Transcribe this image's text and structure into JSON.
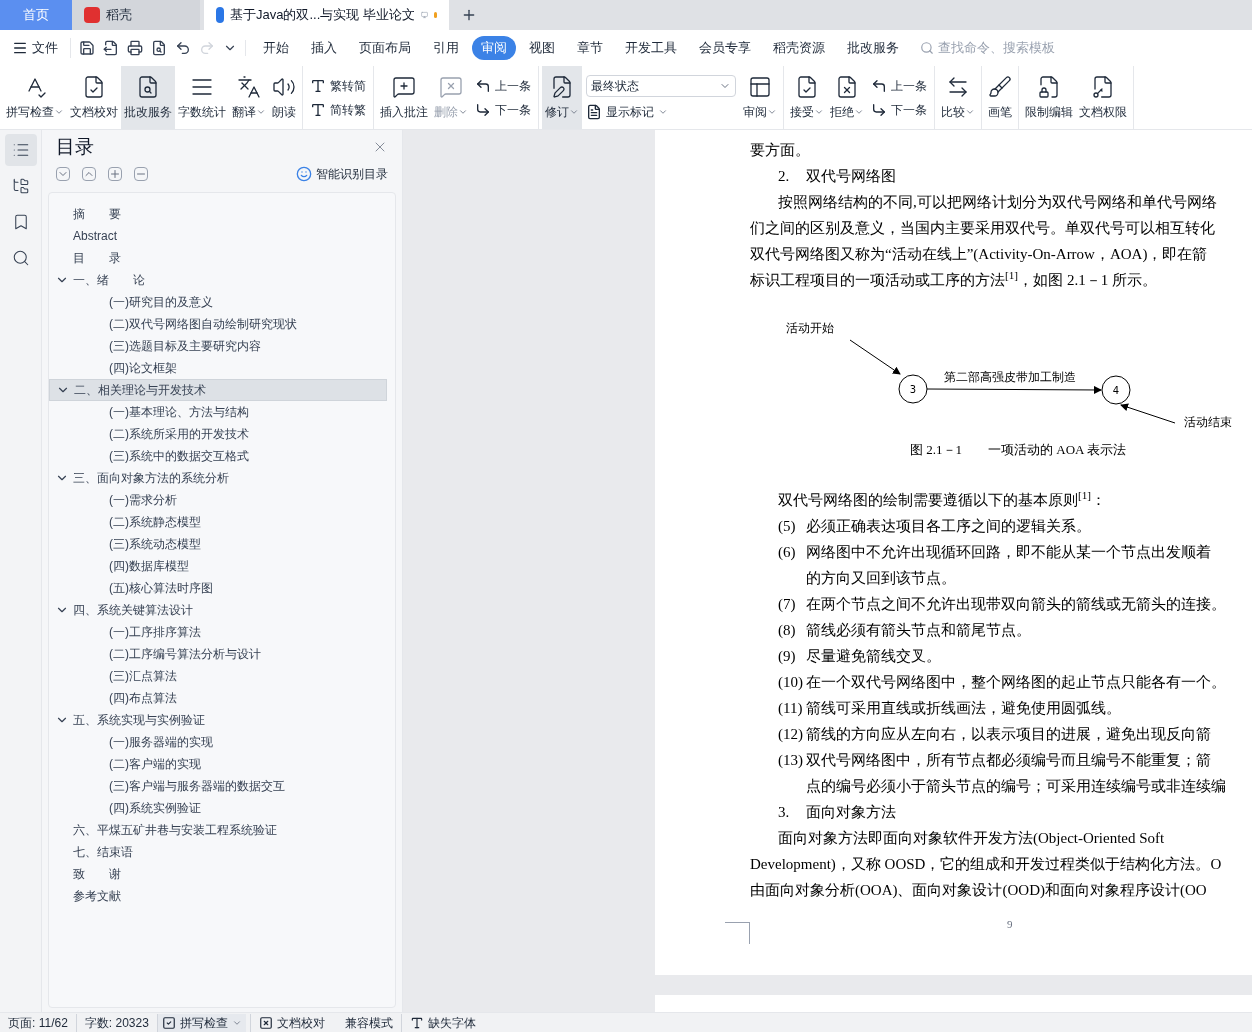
{
  "browser_tabs": [
    {
      "label": "首页",
      "kind": "home",
      "selected": false
    },
    {
      "label": "稻壳",
      "kind": "app",
      "selected": false
    },
    {
      "label": "基于Java的双...与实现 毕业论文",
      "kind": "doc",
      "selected": true,
      "unsaved": true
    }
  ],
  "menu": {
    "file": "文件",
    "tabs": [
      {
        "label": "开始",
        "selected": false
      },
      {
        "label": "插入",
        "selected": false
      },
      {
        "label": "页面布局",
        "selected": false
      },
      {
        "label": "引用",
        "selected": false
      },
      {
        "label": "审阅",
        "selected": true
      },
      {
        "label": "视图",
        "selected": false
      },
      {
        "label": "章节",
        "selected": false
      },
      {
        "label": "开发工具",
        "selected": false
      },
      {
        "label": "会员专享",
        "selected": false
      },
      {
        "label": "稻壳资源",
        "selected": false
      },
      {
        "label": "批改服务",
        "selected": false
      }
    ],
    "search": {
      "placeholder": "查找命令、搜索模板"
    }
  },
  "ribbon": {
    "groups": [
      {
        "items": [
          {
            "kind": "large",
            "label": "拼写检查",
            "has_menu": true,
            "selected": false,
            "disabled": false
          },
          {
            "kind": "large",
            "label": "文档校对",
            "has_menu": false,
            "selected": false,
            "disabled": false
          },
          {
            "kind": "large",
            "label": "批改服务",
            "has_menu": false,
            "selected": true,
            "disabled": false
          },
          {
            "kind": "large",
            "label": "字数统计",
            "has_menu": false,
            "selected": false,
            "disabled": false
          },
          {
            "kind": "large",
            "label": "翻译",
            "has_menu": true,
            "selected": false,
            "disabled": false
          },
          {
            "kind": "large",
            "label": "朗读",
            "has_menu": false,
            "selected": false,
            "disabled": false
          }
        ]
      },
      {
        "items": [
          {
            "kind": "stack",
            "items": [
              {
                "label": "繁转简"
              },
              {
                "label": "简转繁"
              }
            ]
          }
        ]
      },
      {
        "items": [
          {
            "kind": "large",
            "label": "插入批注",
            "has_menu": false,
            "selected": false,
            "disabled": false
          },
          {
            "kind": "large",
            "label": "删除",
            "has_menu": true,
            "selected": false,
            "disabled": true
          },
          {
            "kind": "stack",
            "items": [
              {
                "label": "上一条"
              },
              {
                "label": "下一条"
              }
            ]
          }
        ]
      },
      {
        "items": [
          {
            "kind": "large",
            "label": "修订",
            "has_menu": true,
            "selected": true,
            "disabled": false
          },
          {
            "kind": "select",
            "value": "最终状态",
            "option": "显示标记"
          },
          {
            "kind": "large",
            "label": "审阅",
            "has_menu": true,
            "selected": false,
            "disabled": false
          }
        ]
      },
      {
        "items": [
          {
            "kind": "large",
            "label": "接受",
            "has_menu": true,
            "selected": false,
            "disabled": false
          },
          {
            "kind": "large",
            "label": "拒绝",
            "has_menu": true,
            "selected": false,
            "disabled": false
          },
          {
            "kind": "stack",
            "items": [
              {
                "label": "上一条"
              },
              {
                "label": "下一条"
              }
            ]
          }
        ]
      },
      {
        "items": [
          {
            "kind": "large",
            "label": "比较",
            "has_menu": true,
            "selected": false,
            "disabled": false
          }
        ]
      },
      {
        "items": [
          {
            "kind": "large",
            "label": "画笔",
            "has_menu": false,
            "selected": false,
            "disabled": false
          }
        ]
      },
      {
        "items": [
          {
            "kind": "large",
            "label": "限制编辑",
            "has_menu": false,
            "selected": false,
            "disabled": false
          },
          {
            "kind": "large",
            "label": "文档权限",
            "has_menu": false,
            "selected": false,
            "disabled": false
          }
        ]
      }
    ]
  },
  "side_tools": [
    {
      "selected": true
    },
    {
      "selected": false
    },
    {
      "selected": false
    },
    {
      "selected": false
    }
  ],
  "toc": {
    "title": "目录",
    "smart_button": "智能识别目录",
    "items": [
      {
        "label": "摘　　要",
        "selected": false
      },
      {
        "label": "Abstract",
        "selected": false
      },
      {
        "label": "目　　录",
        "selected": false
      },
      {
        "label": "一、绪　　论",
        "selected": false,
        "expanded": true,
        "children": [
          {
            "label": "(一)研究目的及意义",
            "selected": false
          },
          {
            "label": "(二)双代号网络图自动绘制研究现状",
            "selected": false
          },
          {
            "label": "(三)选题目标及主要研究内容",
            "selected": false
          },
          {
            "label": "(四)论文框架",
            "selected": false
          }
        ]
      },
      {
        "label": "二、相关理论与开发技术",
        "selected": true,
        "expanded": true,
        "children": [
          {
            "label": "(一)基本理论、方法与结构",
            "selected": false
          },
          {
            "label": "(二)系统所采用的开发技术",
            "selected": false
          },
          {
            "label": "(三)系统中的数据交互格式",
            "selected": false
          }
        ]
      },
      {
        "label": "三、面向对象方法的系统分析",
        "selected": false,
        "expanded": true,
        "children": [
          {
            "label": "(一)需求分析",
            "selected": false
          },
          {
            "label": "(二)系统静态模型",
            "selected": false
          },
          {
            "label": "(三)系统动态模型",
            "selected": false
          },
          {
            "label": "(四)数据库模型",
            "selected": false
          },
          {
            "label": "(五)核心算法时序图",
            "selected": false
          }
        ]
      },
      {
        "label": "四、系统关键算法设计",
        "selected": false,
        "expanded": true,
        "children": [
          {
            "label": "(一)工序排序算法",
            "selected": false
          },
          {
            "label": "(二)工序编号算法分析与设计",
            "selected": false
          },
          {
            "label": "(三)汇点算法",
            "selected": false
          },
          {
            "label": "(四)布点算法",
            "selected": false
          }
        ]
      },
      {
        "label": "五、系统实现与实例验证",
        "selected": false,
        "expanded": true,
        "children": [
          {
            "label": "(一)服务器端的实现",
            "selected": false
          },
          {
            "label": "(二)客户端的实现",
            "selected": false
          },
          {
            "label": "(三)客户端与服务器端的数据交互",
            "selected": false
          },
          {
            "label": "(四)系统实例验证",
            "selected": false
          }
        ]
      },
      {
        "label": "六、平煤五矿井巷与安装工程系统验证",
        "selected": false
      },
      {
        "label": "七、结束语",
        "selected": false
      },
      {
        "label": "致　　谢",
        "selected": false
      },
      {
        "label": "参考文献",
        "selected": false
      }
    ]
  },
  "document": {
    "blocks": [
      {
        "kind": "line",
        "text": "要方面。"
      },
      {
        "kind": "heading",
        "number": "2.",
        "text": "双代号网络图"
      },
      {
        "kind": "first_line",
        "text": "按照网络结构的不同,可以把网络计划分为双代号网络和单代号网络"
      },
      {
        "kind": "line",
        "text": "们之间的区别及意义，当国内主要采用双代号。单双代号可以相互转化"
      },
      {
        "kind": "line",
        "text": "双代号网络图又称为“活动在线上”(Activity-On-Arrow，AOA)，即在箭"
      },
      {
        "kind": "line",
        "text": "标识工程项目的一项活动或工序的方法$^{[1]}$，如图 2.1－1 所示。"
      },
      {
        "kind": "figure",
        "start_label": "活动开始",
        "activity": "第二部高强皮带加工制造",
        "from_node": "3",
        "to_node": "4",
        "end_label": "活动结束",
        "caption": "图  2.1－1　　一项活动的 AOA 表示法"
      },
      {
        "kind": "first_line",
        "text": "双代号网络图的绘制需要遵循以下的基本原则$^{[1]}$："
      },
      {
        "kind": "list",
        "number": "(5)",
        "lines": [
          "必须正确表达项目各工序之间的逻辑关系。"
        ]
      },
      {
        "kind": "list",
        "number": "(6)",
        "lines": [
          "网络图中不允许出现循环回路，即不能从某一个节点出发顺着",
          "的方向又回到该节点。"
        ]
      },
      {
        "kind": "list",
        "number": "(7)",
        "lines": [
          "在两个节点之间不允许出现带双向箭头的箭线或无箭头的连接。"
        ]
      },
      {
        "kind": "list",
        "number": "(8)",
        "lines": [
          "箭线必须有箭头节点和箭尾节点。"
        ]
      },
      {
        "kind": "list",
        "number": "(9)",
        "lines": [
          "尽量避免箭线交叉。"
        ]
      },
      {
        "kind": "list",
        "number": "(10)",
        "lines": [
          "在一个双代号网络图中，整个网络图的起止节点只能各有一个。"
        ]
      },
      {
        "kind": "list",
        "number": "(11)",
        "lines": [
          "箭线可采用直线或折线画法，避免使用圆弧线。"
        ]
      },
      {
        "kind": "list",
        "number": "(12)",
        "lines": [
          "箭线的方向应从左向右，以表示项目的进展，避免出现反向箭"
        ]
      },
      {
        "kind": "list",
        "number": "(13)",
        "lines": [
          "双代号网络图中，所有节点都必须编号而且编号不能重复；箭",
          "点的编号必须小于箭头节点的编号；可采用连续编号或非连续编"
        ]
      },
      {
        "kind": "heading",
        "number": "3.",
        "text": "面向对象方法"
      },
      {
        "kind": "first_line",
        "text": "面向对象方法即面向对象软件开发方法(Object-Oriented Soft"
      },
      {
        "kind": "line",
        "text": "Development)，又称 OOSD，它的组成和开发过程类似于结构化方法。O"
      },
      {
        "kind": "line",
        "text": "由面向对象分析(OOA)、面向对象设计(OOD)和面向对象程序设计(OO"
      }
    ],
    "page_number": "9"
  },
  "status_bar": {
    "page": "页面: 11/62",
    "words": "字数: 20323",
    "spell": "拼写检查",
    "proof": "文档校对",
    "mode": "兼容模式",
    "fonts": "缺失字体"
  }
}
